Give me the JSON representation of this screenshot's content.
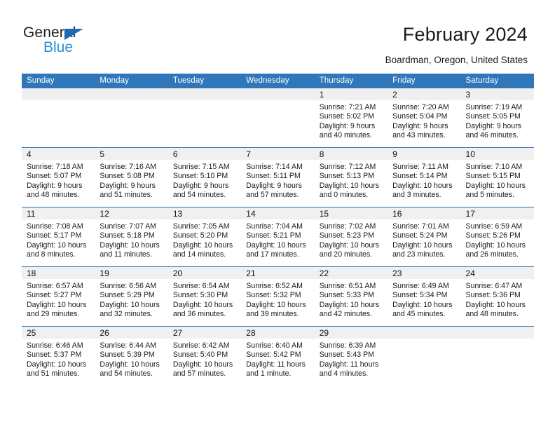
{
  "brand": {
    "name_top": "General",
    "name_bottom": "Blue",
    "triangle_color": "#1a6cb5",
    "blue_text_color": "#2b8ed6"
  },
  "header": {
    "title": "February 2024",
    "subtitle": "Boardman, Oregon, United States"
  },
  "theme": {
    "header_blue": "#3077b9",
    "daynum_strip_bg": "#f0f0f0",
    "text": "#1a1a1a"
  },
  "calendar": {
    "weekday_headers": [
      "Sunday",
      "Monday",
      "Tuesday",
      "Wednesday",
      "Thursday",
      "Friday",
      "Saturday"
    ],
    "weeks": [
      [
        {
          "day": "",
          "sunrise": "",
          "sunset": "",
          "daylight1": "",
          "daylight2": ""
        },
        {
          "day": "",
          "sunrise": "",
          "sunset": "",
          "daylight1": "",
          "daylight2": ""
        },
        {
          "day": "",
          "sunrise": "",
          "sunset": "",
          "daylight1": "",
          "daylight2": ""
        },
        {
          "day": "",
          "sunrise": "",
          "sunset": "",
          "daylight1": "",
          "daylight2": ""
        },
        {
          "day": "1",
          "sunrise": "Sunrise: 7:21 AM",
          "sunset": "Sunset: 5:02 PM",
          "daylight1": "Daylight: 9 hours",
          "daylight2": "and 40 minutes."
        },
        {
          "day": "2",
          "sunrise": "Sunrise: 7:20 AM",
          "sunset": "Sunset: 5:04 PM",
          "daylight1": "Daylight: 9 hours",
          "daylight2": "and 43 minutes."
        },
        {
          "day": "3",
          "sunrise": "Sunrise: 7:19 AM",
          "sunset": "Sunset: 5:05 PM",
          "daylight1": "Daylight: 9 hours",
          "daylight2": "and 46 minutes."
        }
      ],
      [
        {
          "day": "4",
          "sunrise": "Sunrise: 7:18 AM",
          "sunset": "Sunset: 5:07 PM",
          "daylight1": "Daylight: 9 hours",
          "daylight2": "and 48 minutes."
        },
        {
          "day": "5",
          "sunrise": "Sunrise: 7:16 AM",
          "sunset": "Sunset: 5:08 PM",
          "daylight1": "Daylight: 9 hours",
          "daylight2": "and 51 minutes."
        },
        {
          "day": "6",
          "sunrise": "Sunrise: 7:15 AM",
          "sunset": "Sunset: 5:10 PM",
          "daylight1": "Daylight: 9 hours",
          "daylight2": "and 54 minutes."
        },
        {
          "day": "7",
          "sunrise": "Sunrise: 7:14 AM",
          "sunset": "Sunset: 5:11 PM",
          "daylight1": "Daylight: 9 hours",
          "daylight2": "and 57 minutes."
        },
        {
          "day": "8",
          "sunrise": "Sunrise: 7:12 AM",
          "sunset": "Sunset: 5:13 PM",
          "daylight1": "Daylight: 10 hours",
          "daylight2": "and 0 minutes."
        },
        {
          "day": "9",
          "sunrise": "Sunrise: 7:11 AM",
          "sunset": "Sunset: 5:14 PM",
          "daylight1": "Daylight: 10 hours",
          "daylight2": "and 3 minutes."
        },
        {
          "day": "10",
          "sunrise": "Sunrise: 7:10 AM",
          "sunset": "Sunset: 5:15 PM",
          "daylight1": "Daylight: 10 hours",
          "daylight2": "and 5 minutes."
        }
      ],
      [
        {
          "day": "11",
          "sunrise": "Sunrise: 7:08 AM",
          "sunset": "Sunset: 5:17 PM",
          "daylight1": "Daylight: 10 hours",
          "daylight2": "and 8 minutes."
        },
        {
          "day": "12",
          "sunrise": "Sunrise: 7:07 AM",
          "sunset": "Sunset: 5:18 PM",
          "daylight1": "Daylight: 10 hours",
          "daylight2": "and 11 minutes."
        },
        {
          "day": "13",
          "sunrise": "Sunrise: 7:05 AM",
          "sunset": "Sunset: 5:20 PM",
          "daylight1": "Daylight: 10 hours",
          "daylight2": "and 14 minutes."
        },
        {
          "day": "14",
          "sunrise": "Sunrise: 7:04 AM",
          "sunset": "Sunset: 5:21 PM",
          "daylight1": "Daylight: 10 hours",
          "daylight2": "and 17 minutes."
        },
        {
          "day": "15",
          "sunrise": "Sunrise: 7:02 AM",
          "sunset": "Sunset: 5:23 PM",
          "daylight1": "Daylight: 10 hours",
          "daylight2": "and 20 minutes."
        },
        {
          "day": "16",
          "sunrise": "Sunrise: 7:01 AM",
          "sunset": "Sunset: 5:24 PM",
          "daylight1": "Daylight: 10 hours",
          "daylight2": "and 23 minutes."
        },
        {
          "day": "17",
          "sunrise": "Sunrise: 6:59 AM",
          "sunset": "Sunset: 5:26 PM",
          "daylight1": "Daylight: 10 hours",
          "daylight2": "and 26 minutes."
        }
      ],
      [
        {
          "day": "18",
          "sunrise": "Sunrise: 6:57 AM",
          "sunset": "Sunset: 5:27 PM",
          "daylight1": "Daylight: 10 hours",
          "daylight2": "and 29 minutes."
        },
        {
          "day": "19",
          "sunrise": "Sunrise: 6:56 AM",
          "sunset": "Sunset: 5:29 PM",
          "daylight1": "Daylight: 10 hours",
          "daylight2": "and 32 minutes."
        },
        {
          "day": "20",
          "sunrise": "Sunrise: 6:54 AM",
          "sunset": "Sunset: 5:30 PM",
          "daylight1": "Daylight: 10 hours",
          "daylight2": "and 36 minutes."
        },
        {
          "day": "21",
          "sunrise": "Sunrise: 6:52 AM",
          "sunset": "Sunset: 5:32 PM",
          "daylight1": "Daylight: 10 hours",
          "daylight2": "and 39 minutes."
        },
        {
          "day": "22",
          "sunrise": "Sunrise: 6:51 AM",
          "sunset": "Sunset: 5:33 PM",
          "daylight1": "Daylight: 10 hours",
          "daylight2": "and 42 minutes."
        },
        {
          "day": "23",
          "sunrise": "Sunrise: 6:49 AM",
          "sunset": "Sunset: 5:34 PM",
          "daylight1": "Daylight: 10 hours",
          "daylight2": "and 45 minutes."
        },
        {
          "day": "24",
          "sunrise": "Sunrise: 6:47 AM",
          "sunset": "Sunset: 5:36 PM",
          "daylight1": "Daylight: 10 hours",
          "daylight2": "and 48 minutes."
        }
      ],
      [
        {
          "day": "25",
          "sunrise": "Sunrise: 6:46 AM",
          "sunset": "Sunset: 5:37 PM",
          "daylight1": "Daylight: 10 hours",
          "daylight2": "and 51 minutes."
        },
        {
          "day": "26",
          "sunrise": "Sunrise: 6:44 AM",
          "sunset": "Sunset: 5:39 PM",
          "daylight1": "Daylight: 10 hours",
          "daylight2": "and 54 minutes."
        },
        {
          "day": "27",
          "sunrise": "Sunrise: 6:42 AM",
          "sunset": "Sunset: 5:40 PM",
          "daylight1": "Daylight: 10 hours",
          "daylight2": "and 57 minutes."
        },
        {
          "day": "28",
          "sunrise": "Sunrise: 6:40 AM",
          "sunset": "Sunset: 5:42 PM",
          "daylight1": "Daylight: 11 hours",
          "daylight2": "and 1 minute."
        },
        {
          "day": "29",
          "sunrise": "Sunrise: 6:39 AM",
          "sunset": "Sunset: 5:43 PM",
          "daylight1": "Daylight: 11 hours",
          "daylight2": "and 4 minutes."
        },
        {
          "day": "",
          "sunrise": "",
          "sunset": "",
          "daylight1": "",
          "daylight2": ""
        },
        {
          "day": "",
          "sunrise": "",
          "sunset": "",
          "daylight1": "",
          "daylight2": ""
        }
      ]
    ]
  }
}
